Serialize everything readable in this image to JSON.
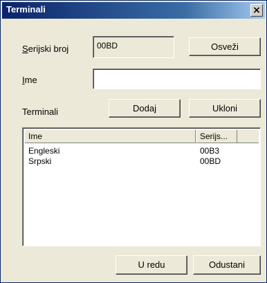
{
  "window": {
    "title": "Terminali",
    "close_glyph": "×"
  },
  "serial": {
    "label_underline": "S",
    "label_rest": "erijski broj",
    "value": "00BD",
    "refresh_label": "Osveži"
  },
  "name": {
    "label_underline": "I",
    "label_rest": "me",
    "value": "",
    "placeholder": ""
  },
  "terminals": {
    "label": "Terminali",
    "add_label": "Dodaj",
    "remove_label": "Ukloni",
    "columns": [
      "Ime",
      "Serijs..."
    ],
    "rows": [
      [
        "Engleski",
        "00B3"
      ],
      [
        "Srpski",
        "00BD"
      ]
    ]
  },
  "footer": {
    "ok_label": "U redu",
    "cancel_label": "Odustani"
  },
  "icons": {
    "close": "close-icon"
  },
  "colors": {
    "title_start": "#0a246a",
    "title_end": "#a6caf0",
    "face": "#ece9d8"
  }
}
